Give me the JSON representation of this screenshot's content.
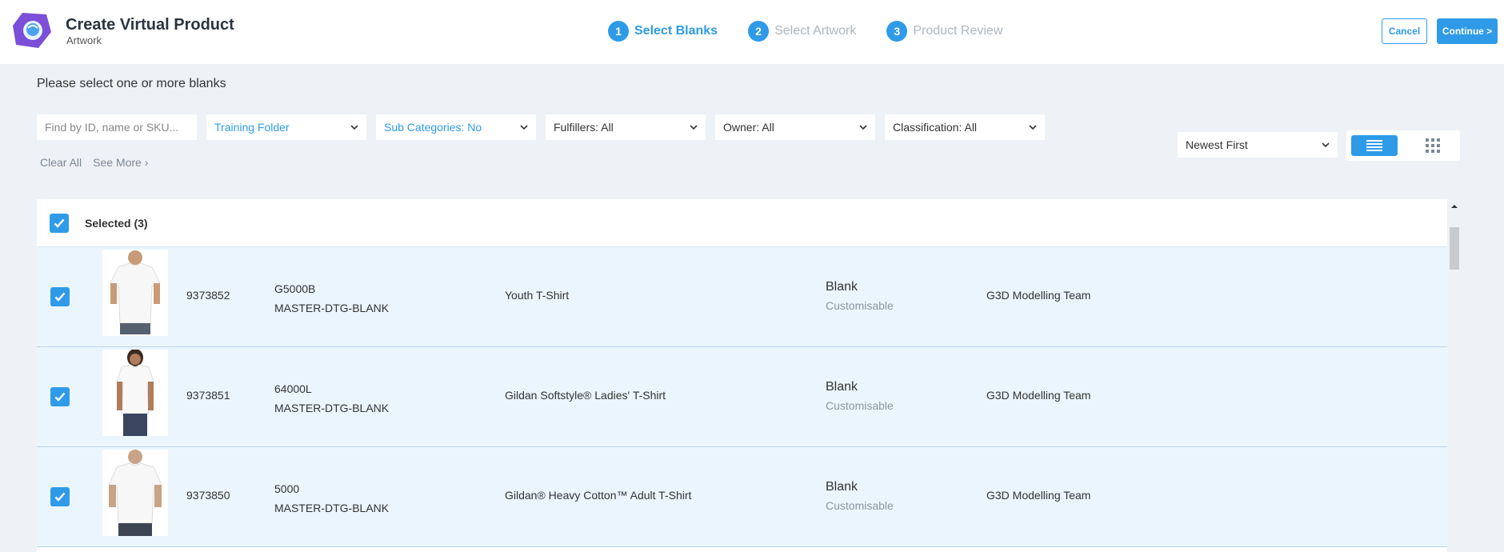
{
  "header": {
    "title": "Create Virtual Product",
    "subtitle": "Artwork",
    "steps": [
      {
        "num": "1",
        "label": "Select Blanks"
      },
      {
        "num": "2",
        "label": "Select Artwork"
      },
      {
        "num": "3",
        "label": "Product Review"
      }
    ],
    "cancel_label": "Cancel",
    "continue_label": "Continue >"
  },
  "instruction": "Please select one or more blanks",
  "filters": {
    "search_placeholder": "Find by ID, name or SKU...",
    "folder": "Training Folder",
    "subcategories": "Sub Categories: No",
    "fulfillers": "Fulfillers: All",
    "owner": "Owner: All",
    "classification": "Classification: All",
    "clear_all": "Clear All",
    "see_more": "See More ›"
  },
  "sort": {
    "selected": "Newest First"
  },
  "table": {
    "selected_label": "Selected (3)",
    "rows": [
      {
        "id": "9373852",
        "code": "G5000B",
        "sku": "MASTER-DTG-BLANK",
        "name": "Youth T-Shirt",
        "type": "Blank",
        "subtype": "Customisable",
        "owner": "G3D Modelling Team"
      },
      {
        "id": "9373851",
        "code": "64000L",
        "sku": "MASTER-DTG-BLANK",
        "name": "Gildan Softstyle® Ladies' T-Shirt",
        "type": "Blank",
        "subtype": "Customisable",
        "owner": "G3D Modelling Team"
      },
      {
        "id": "9373850",
        "code": "5000",
        "sku": "MASTER-DTG-BLANK",
        "name": "Gildan® Heavy Cotton™ Adult T-Shirt",
        "type": "Blank",
        "subtype": "Customisable",
        "owner": "G3D Modelling Team"
      }
    ]
  },
  "colors": {
    "accent": "#2f9be8",
    "row_bg": "#eaf5fd",
    "page_bg": "#eef2f6"
  }
}
